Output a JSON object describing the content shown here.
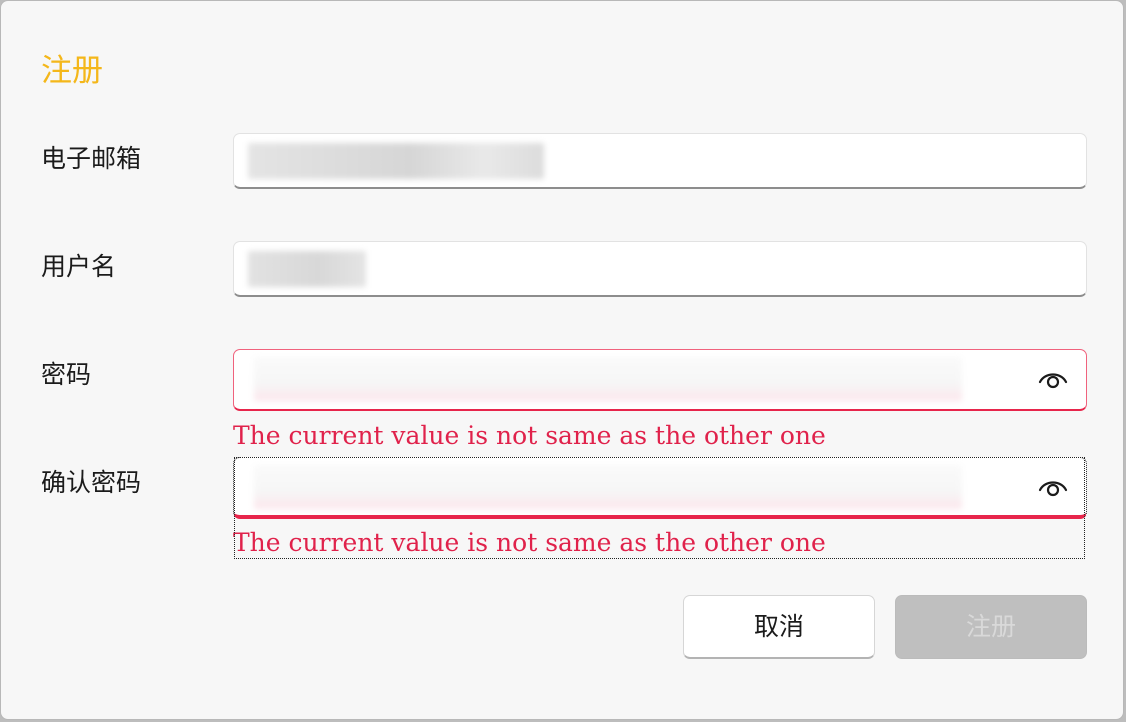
{
  "dialog": {
    "title": "注册"
  },
  "fields": {
    "email": {
      "label": "电子邮箱"
    },
    "username": {
      "label": "用户名"
    },
    "password": {
      "label": "密码",
      "error": "The current value is not same as the other one",
      "icon": "eye-icon"
    },
    "confirm_password": {
      "label": "确认密码",
      "error": "The current value is not same as the other one",
      "icon": "eye-icon"
    }
  },
  "buttons": {
    "cancel_label": "取消",
    "submit_label": "注册"
  },
  "colors": {
    "title": "#f4b71a",
    "error": "#e0224b",
    "error_border": "#e7254b",
    "submit_disabled_bg": "#bfbfbf"
  }
}
